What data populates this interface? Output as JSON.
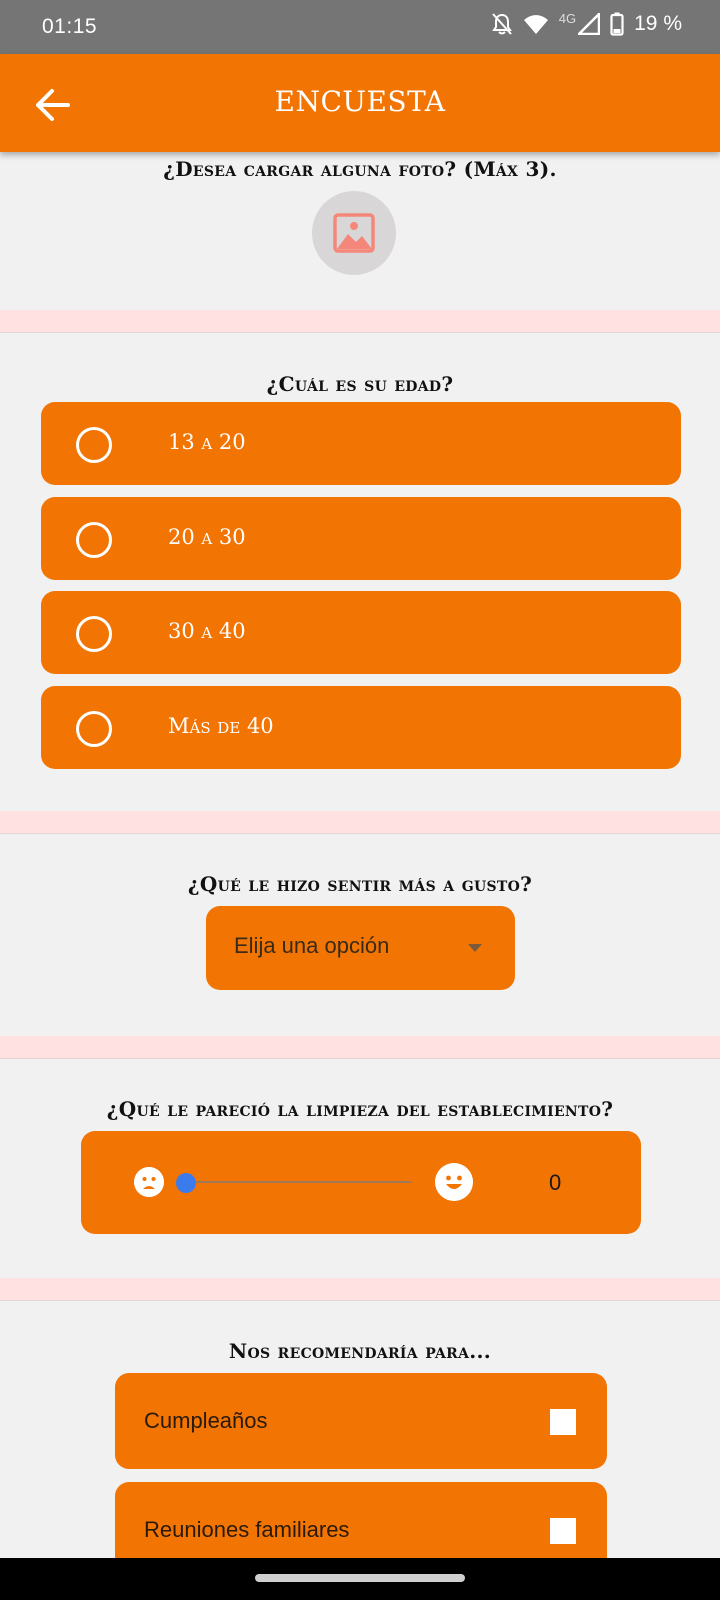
{
  "status_bar": {
    "time": "01:15",
    "network": "4G",
    "battery": "19 %",
    "icons": [
      "notifications-off-icon",
      "wifi-icon",
      "signal-icon",
      "battery-icon"
    ]
  },
  "app_bar": {
    "title": "ENCUESTA",
    "back_icon": "arrow-back-icon"
  },
  "photo_section": {
    "question": "¿Desea cargar alguna foto? (Máx 3).",
    "icon": "image-icon"
  },
  "age_section": {
    "question": "¿Cuál es su edad?",
    "options": [
      "13 a 20",
      "20 a 30",
      "30 a 40",
      "Más de 40"
    ],
    "selected": null
  },
  "comfort_section": {
    "question": "¿Qué le hizo sentir más a gusto?",
    "dropdown_value": "Elija una opción"
  },
  "cleanliness_section": {
    "question": "¿Qué le pareció la limpieza del establecimiento?",
    "min_icon": "sad-face-icon",
    "max_icon": "happy-face-icon",
    "value": "0",
    "value_fraction": 0
  },
  "recommend_section": {
    "question": "Nos recomendaría para...",
    "options": [
      {
        "label": "Cumpleaños",
        "checked": false
      },
      {
        "label": "Reuniones familiares",
        "checked": false
      }
    ]
  },
  "colors": {
    "accent": "#f27504",
    "background": "#f2f1f1",
    "separator": "#ffe1e1",
    "slider_thumb": "#3b7bec"
  }
}
